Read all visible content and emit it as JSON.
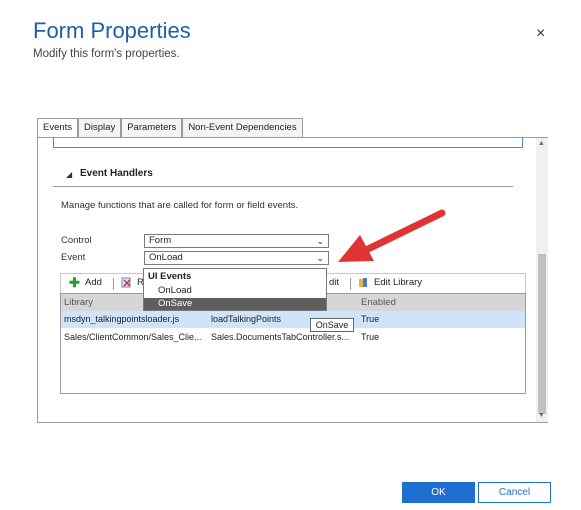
{
  "dialog": {
    "title": "Form Properties",
    "subtitle": "Modify this form's properties.",
    "close": "×"
  },
  "tabs": [
    "Events",
    "Display",
    "Parameters",
    "Non-Event Dependencies"
  ],
  "section": {
    "toggle": "◢",
    "title": "Event Handlers",
    "description": "Manage functions that are called for form or field events."
  },
  "fields": {
    "control_label": "Control",
    "control_value": "Form",
    "event_label": "Event",
    "event_value": "OnLoad",
    "chevron": "⌄"
  },
  "toolbar": {
    "add": "Add",
    "remove_partial": "R",
    "edit_partial": "dit",
    "edit_library": "Edit Library"
  },
  "grid": {
    "headers": [
      "Library",
      "Enabled"
    ],
    "rows": [
      {
        "library": "msdyn_talkingpointsloader.js",
        "function": "loadTalkingPoints",
        "enabled": "True"
      },
      {
        "library": "Sales/ClientCommon/Sales_Clie...",
        "function": "Sales.DocumentsTabController.s...",
        "enabled": "True"
      }
    ]
  },
  "dropdown": {
    "group": "UI Events",
    "items": [
      "OnLoad",
      "OnSave"
    ]
  },
  "tooltip": "OnSave",
  "buttons": {
    "ok": "OK",
    "cancel": "Cancel"
  },
  "colors": {
    "accent": "#1f6fd0",
    "title": "#1f5fa8",
    "arrow": "#e03434",
    "selected_row": "#cfe3fb",
    "dropdown_highlight": "#5e5e5e"
  }
}
